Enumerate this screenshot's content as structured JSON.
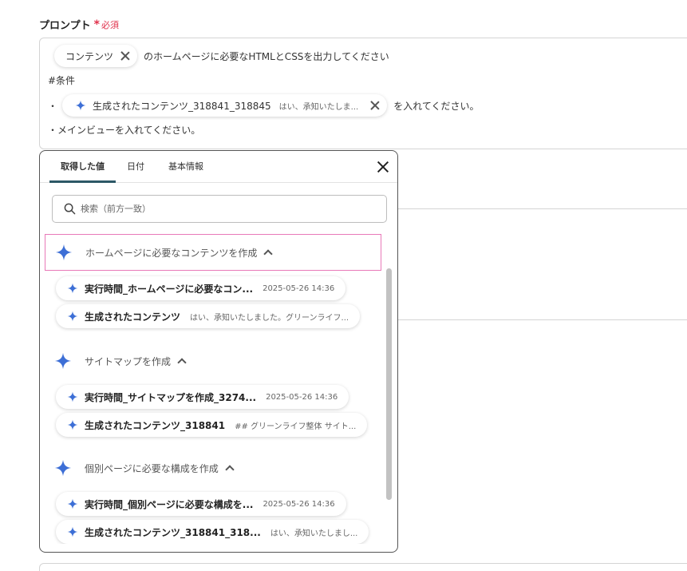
{
  "field": {
    "label": "プロンプト",
    "required_mark": "*",
    "required_text": "必須"
  },
  "prompt": {
    "line1": {
      "chip_label": "コンテンツ",
      "text": "のホームページに必要なHTMLとCSSを出力してください"
    },
    "line2": {
      "text": "#条件"
    },
    "line3": {
      "bullet": "・",
      "chip_label": "生成されたコンテンツ_318841_318845",
      "chip_sub": "はい、承知いたしま...",
      "text": "を入れてください。"
    },
    "line4": {
      "text": "・メインビューを入れてください。"
    }
  },
  "popup": {
    "tabs": [
      {
        "label": "取得した値"
      },
      {
        "label": "日付"
      },
      {
        "label": "基本情報"
      }
    ],
    "search_placeholder": "検索（前方一致）",
    "groups": [
      {
        "title": "ホームページに必要なコンテンツを作成",
        "items": [
          {
            "name": "実行時間_ホームページに必要なコン...",
            "meta": "2025-05-26 14:36"
          },
          {
            "name": "生成されたコンテンツ",
            "meta": "はい、承知いたしました。グリーンライフ..."
          }
        ]
      },
      {
        "title": "サイトマップを作成",
        "items": [
          {
            "name": "実行時間_サイトマップを作成_3274...",
            "meta": "2025-05-26 14:36"
          },
          {
            "name": "生成されたコンテンツ_318841",
            "meta": "## グリーンライフ整体 サイト..."
          }
        ]
      },
      {
        "title": "個別ページに必要な構成を作成",
        "items": [
          {
            "name": "実行時間_個別ページに必要な構成を...",
            "meta": "2025-05-26 14:36"
          },
          {
            "name": "生成されたコンテンツ_318841_318...",
            "meta": "はい、承知いたしまし..."
          }
        ]
      }
    ]
  },
  "colors": {
    "accent": "#2c5866",
    "required": "#e0314b",
    "highlight": "#e879b8",
    "sparkle": "#3d6fd6"
  }
}
